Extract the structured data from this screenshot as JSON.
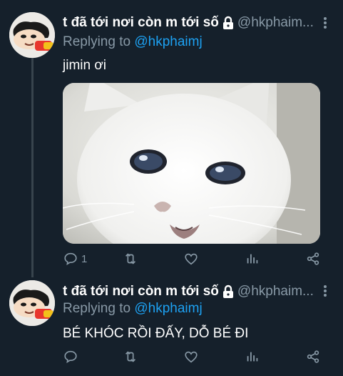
{
  "tweets": [
    {
      "display_name": "t đã tới nơi còn m tới số",
      "handle": "@hkphaim...",
      "replying_prefix": "Replying to ",
      "replying_to": "@hkphaimj",
      "text": "jimin ơi",
      "reply_count": "1"
    },
    {
      "display_name": "t đã tới nơi còn m tới số",
      "handle": "@hkphaim...",
      "replying_prefix": "Replying to ",
      "replying_to": "@hkphaimj",
      "text": "BÉ KHÓC RỒI ĐẤY, DỖ BÉ ĐI",
      "reply_count": ""
    }
  ],
  "colors": {
    "background": "#15202b",
    "secondary_text": "#8899a6",
    "accent": "#1da1f2",
    "thread_line": "#38444d"
  },
  "icons": [
    "lock-icon",
    "more-icon",
    "reply-icon",
    "retweet-icon",
    "like-icon",
    "stats-icon",
    "share-icon"
  ]
}
